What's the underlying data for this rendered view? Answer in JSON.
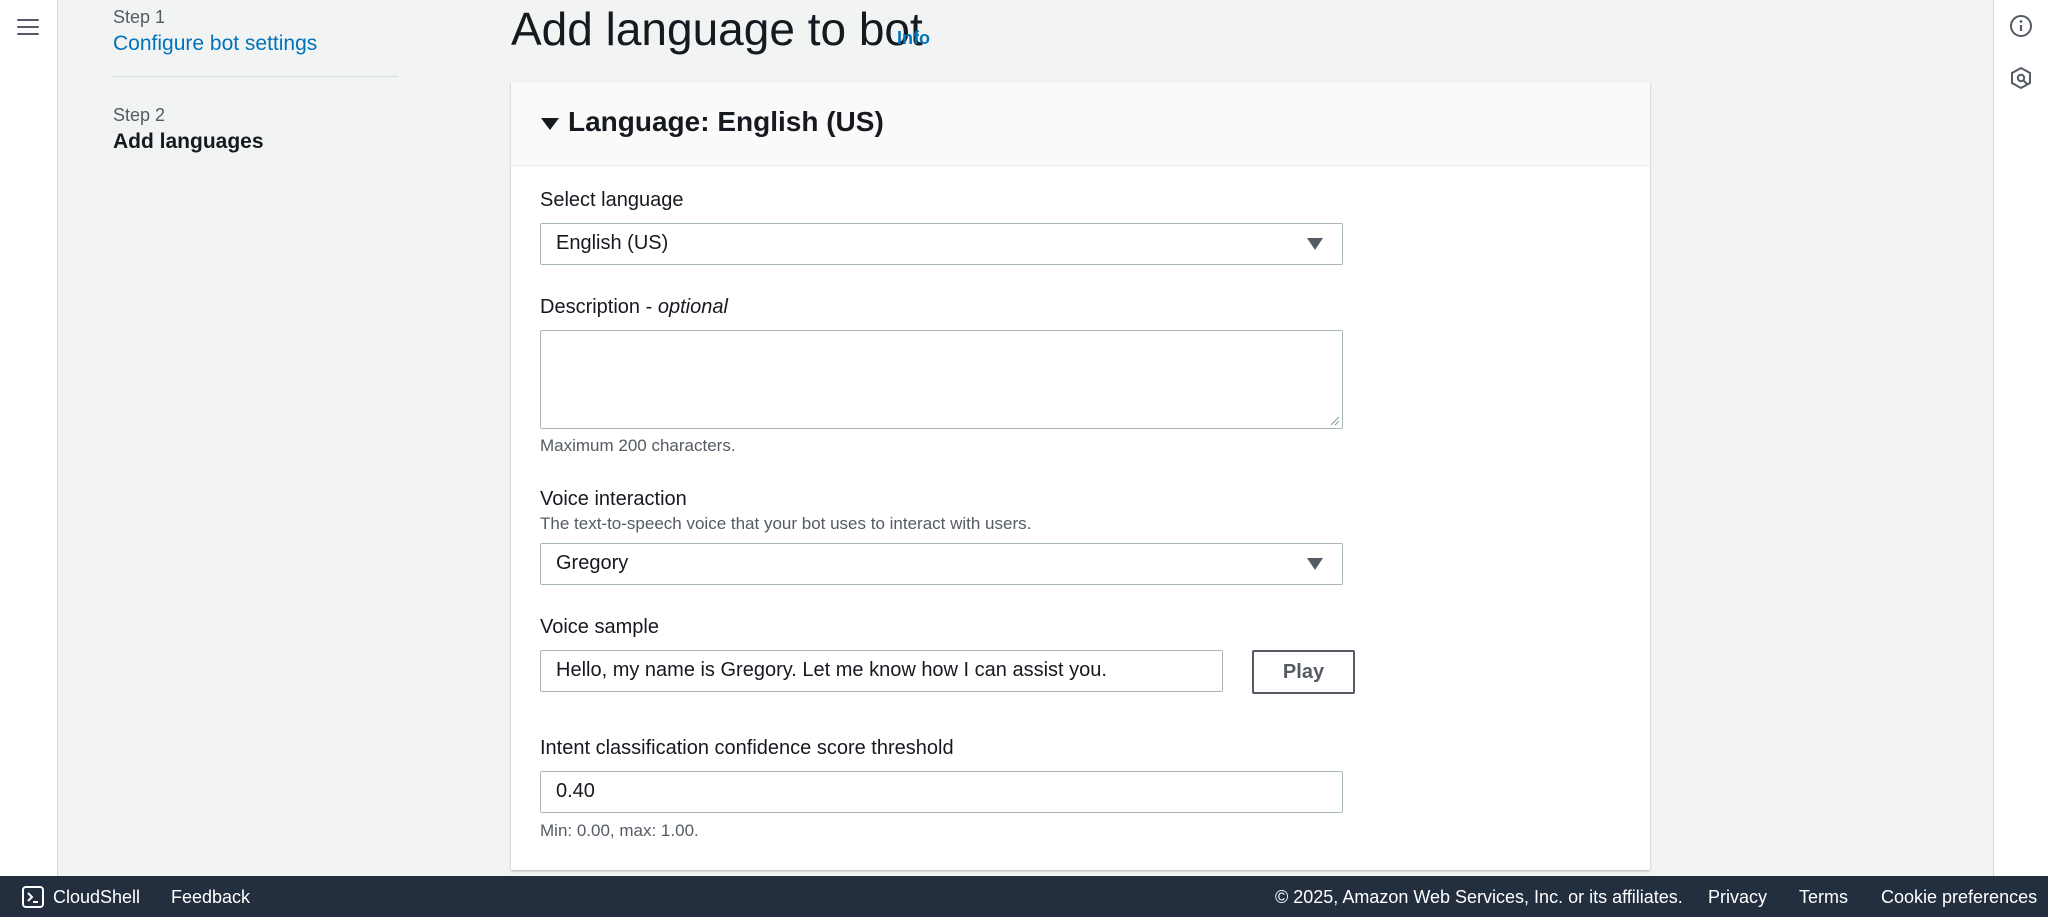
{
  "steps": [
    {
      "number": "Step 1",
      "label": "Configure bot settings"
    },
    {
      "number": "Step 2",
      "label": "Add languages"
    }
  ],
  "header": {
    "title": "Add language to bot",
    "info": "Info"
  },
  "panel": {
    "title": "Language: English (US)",
    "select_language": {
      "label": "Select language",
      "value": "English (US)"
    },
    "description": {
      "label": "Description -",
      "label_optional": "optional",
      "value": "",
      "hint": "Maximum 200 characters."
    },
    "voice_interaction": {
      "label": "Voice interaction",
      "hint": "The text-to-speech voice that your bot uses to interact with users.",
      "value": "Gregory"
    },
    "voice_sample": {
      "label": "Voice sample",
      "value": "Hello, my name is Gregory. Let me know how I can assist you.",
      "play_label": "Play"
    },
    "confidence": {
      "label": "Intent classification confidence score threshold",
      "value": "0.40",
      "hint": "Min: 0.00, max: 1.00."
    }
  },
  "footer": {
    "cloudshell": "CloudShell",
    "feedback": "Feedback",
    "copyright": "© 2025, Amazon Web Services, Inc. or its affiliates.",
    "privacy": "Privacy",
    "terms": "Terms",
    "cookies": "Cookie preferences"
  },
  "icons": {
    "menu": "hamburger-menu-icon",
    "info": "info-circle-icon",
    "settings": "hexagon-settings-icon",
    "cloudshell": "terminal-icon",
    "caret": "caret-down-icon"
  },
  "colors": {
    "link": "#0073bb",
    "footer_bg": "#232f3e",
    "page_bg": "#f2f3f3"
  }
}
